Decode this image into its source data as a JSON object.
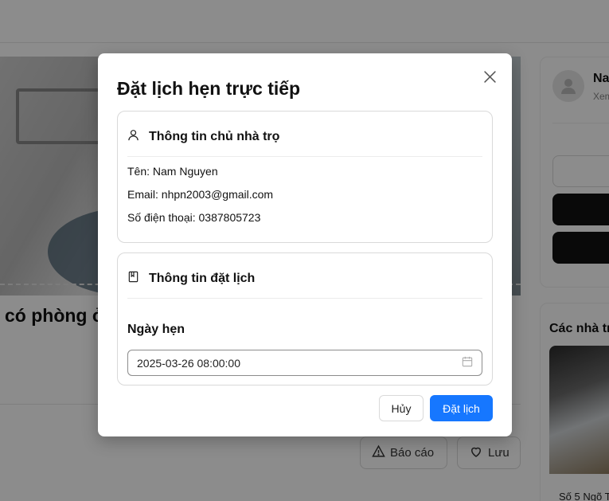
{
  "background": {
    "listing_title": "có phòng ở",
    "report_button": "Báo cáo",
    "save_button": "Lưu",
    "owner_name": "Na",
    "owner_sub": "Xem",
    "section_title": "Các nhà trọ",
    "thumb_caption": "Số 5 Ngõ T"
  },
  "modal": {
    "title": "Đặt lịch hẹn trực tiếp",
    "close_icon": "close-icon",
    "owner_section": {
      "title": "Thông tin chủ nhà trọ",
      "icon": "user-icon",
      "name_line": "Tên: Nam Nguyen",
      "email_line": "Email: nhpn2003@gmail.com",
      "phone_line": "Số điện thoại: 0387805723"
    },
    "booking_section": {
      "title": "Thông tin đặt lịch",
      "icon": "book-icon",
      "date_label": "Ngày hẹn",
      "date_value": "2025-03-26 08:00:00",
      "date_icon": "calendar-icon"
    },
    "cancel_button": "Hủy",
    "submit_button": "Đặt lịch",
    "accent_color": "#1677ff"
  }
}
